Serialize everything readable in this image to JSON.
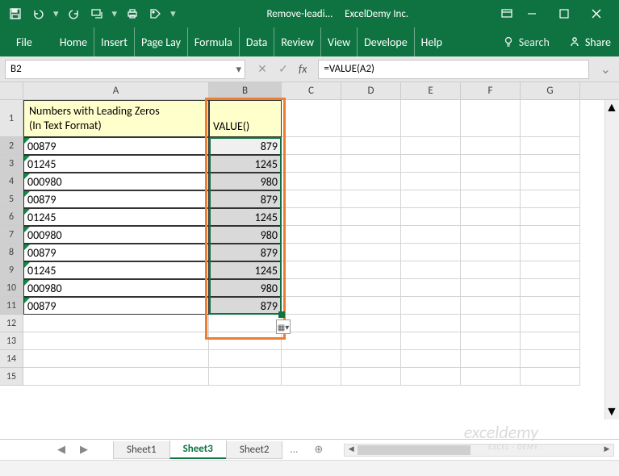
{
  "title": {
    "filename": "Remove-leadi...",
    "company": "ExcelDemy Inc."
  },
  "ribbon": {
    "tabs": [
      "File",
      "Home",
      "Insert",
      "Page Lay",
      "Formula",
      "Data",
      "Review",
      "View",
      "Develope",
      "Help"
    ],
    "search": "Search",
    "share": "Share"
  },
  "namebox": "B2",
  "formula": "=VALUE(A2)",
  "columns": [
    "A",
    "B",
    "C",
    "D",
    "E",
    "F",
    "G"
  ],
  "header": {
    "A_line1": "Numbers with Leading Zeros",
    "A_line2": "(In Text Format)",
    "B": "VALUE()"
  },
  "rows": [
    {
      "n": 2,
      "A": "00879",
      "B": "879"
    },
    {
      "n": 3,
      "A": "01245",
      "B": "1245"
    },
    {
      "n": 4,
      "A": "000980",
      "B": "980"
    },
    {
      "n": 5,
      "A": "00879",
      "B": "879"
    },
    {
      "n": 6,
      "A": "01245",
      "B": "1245"
    },
    {
      "n": 7,
      "A": "000980",
      "B": "980"
    },
    {
      "n": 8,
      "A": "00879",
      "B": "879"
    },
    {
      "n": 9,
      "A": "01245",
      "B": "1245"
    },
    {
      "n": 10,
      "A": "000980",
      "B": "980"
    },
    {
      "n": 11,
      "A": "00879",
      "B": "879"
    }
  ],
  "sheets": {
    "items": [
      "Sheet1",
      "Sheet3",
      "Sheet2"
    ],
    "active": "Sheet3",
    "extra": "..."
  },
  "watermark": {
    "main": "exceldemy",
    "sub": "EXCEL · DEMY"
  }
}
